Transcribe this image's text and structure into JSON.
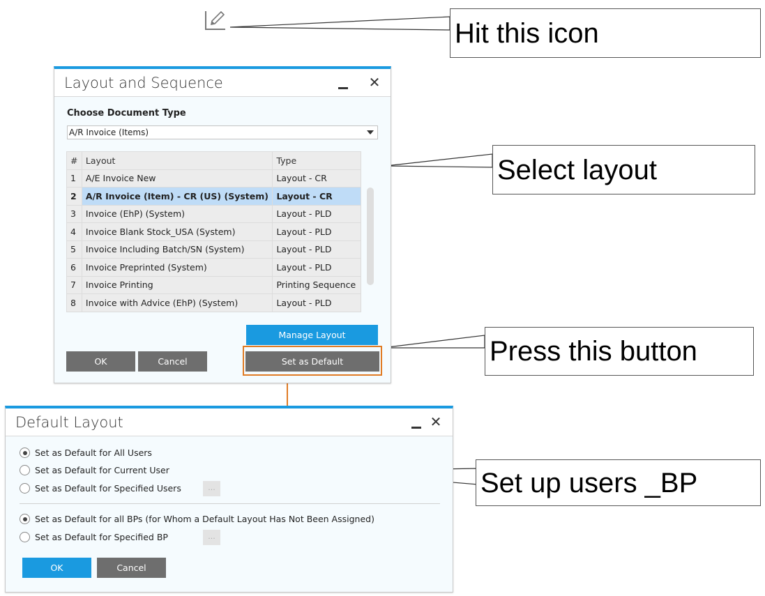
{
  "annotations": {
    "hit_icon": "Hit this icon",
    "select_layout": "Select layout",
    "press_button": "Press this button",
    "setup_users": "Set up users _BP"
  },
  "toolbar": {
    "edit_layout_icon": "edit-layout-icon"
  },
  "layout_dialog": {
    "title": "Layout and Sequence",
    "minimize_label": "_",
    "close_label": "✕",
    "doc_type_label": "Choose Document Type",
    "doc_type_value": "A/R Invoice (Items)",
    "columns": {
      "num": "#",
      "layout": "Layout",
      "type": "Type"
    },
    "rows": [
      {
        "num": "1",
        "layout": "A/E Invoice New",
        "type": "Layout - CR"
      },
      {
        "num": "2",
        "layout": "A/R Invoice (Item) - CR (US) (System)",
        "type": "Layout - CR",
        "selected": true
      },
      {
        "num": "3",
        "layout": "Invoice (EhP) (System)",
        "type": "Layout - PLD"
      },
      {
        "num": "4",
        "layout": "Invoice Blank Stock_USA (System)",
        "type": "Layout - PLD"
      },
      {
        "num": "5",
        "layout": "Invoice Including Batch/SN (System)",
        "type": "Layout - PLD"
      },
      {
        "num": "6",
        "layout": "Invoice Preprinted (System)",
        "type": "Layout - PLD"
      },
      {
        "num": "7",
        "layout": "Invoice Printing",
        "type": "Printing Sequence"
      },
      {
        "num": "8",
        "layout": "Invoice with Advice (EhP) (System)",
        "type": "Layout - PLD"
      }
    ],
    "buttons": {
      "manage_layout": "Manage Layout",
      "ok": "OK",
      "cancel": "Cancel",
      "set_as_default": "Set as Default"
    }
  },
  "default_dialog": {
    "title": "Default Layout",
    "minimize_label": "_",
    "close_label": "✕",
    "user_options": [
      {
        "label": "Set as Default for All Users",
        "checked": true
      },
      {
        "label": "Set as Default for Current User",
        "checked": false
      },
      {
        "label": "Set as Default for Specified Users",
        "checked": false
      }
    ],
    "bp_options": [
      {
        "label": "Set as Default for all BPs (for Whom a Default Layout Has Not Been Assigned)",
        "checked": true
      },
      {
        "label": "Set as Default for Specified BP",
        "checked": false
      }
    ],
    "ellipsis_label": "...",
    "buttons": {
      "ok": "OK",
      "cancel": "Cancel"
    }
  },
  "colors": {
    "accent_blue": "#1a9ae0",
    "button_gray": "#6e6e6e",
    "highlight_orange": "#e07b24",
    "selected_row": "#bfdcf7"
  }
}
